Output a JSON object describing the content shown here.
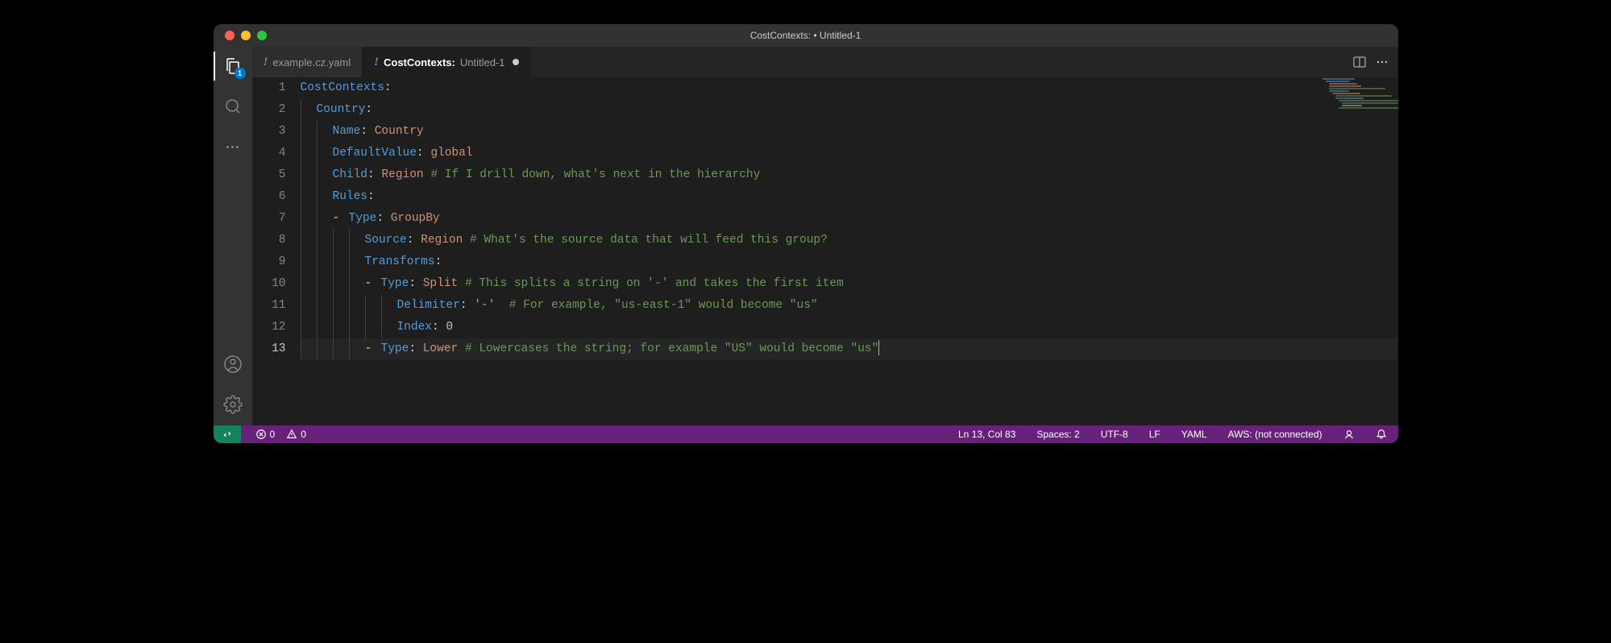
{
  "window": {
    "title": "CostContexts: • Untitled-1"
  },
  "sidebar": {
    "explorer_badge": "1"
  },
  "tabs": [
    {
      "icon": "!",
      "label": "example.cz.yaml",
      "dirty": false,
      "active": false
    },
    {
      "icon": "!",
      "label_main": "CostContexts:",
      "label_sub": "Untitled-1",
      "dirty": true,
      "active": true
    }
  ],
  "editor": {
    "line_numbers": [
      "1",
      "2",
      "3",
      "4",
      "5",
      "6",
      "7",
      "8",
      "9",
      "10",
      "11",
      "12",
      "13"
    ],
    "cursor_line": 13,
    "lines": [
      {
        "indent": 0,
        "tokens": [
          {
            "t": "CostContexts",
            "c": "k1"
          },
          {
            "t": ":",
            "c": "p"
          }
        ]
      },
      {
        "indent": 1,
        "tokens": [
          {
            "t": "Country",
            "c": "k1"
          },
          {
            "t": ":",
            "c": "p"
          }
        ]
      },
      {
        "indent": 2,
        "tokens": [
          {
            "t": "Name",
            "c": "k1"
          },
          {
            "t": ": ",
            "c": "p"
          },
          {
            "t": "Country",
            "c": "vstr"
          }
        ]
      },
      {
        "indent": 2,
        "tokens": [
          {
            "t": "DefaultValue",
            "c": "k1"
          },
          {
            "t": ": ",
            "c": "p"
          },
          {
            "t": "global",
            "c": "vstr"
          }
        ]
      },
      {
        "indent": 2,
        "tokens": [
          {
            "t": "Child",
            "c": "k1"
          },
          {
            "t": ": ",
            "c": "p"
          },
          {
            "t": "Region",
            "c": "vstr"
          },
          {
            "t": " ",
            "c": "p"
          },
          {
            "t": "# If I drill down, what's next in the hierarchy",
            "c": "cmt"
          }
        ]
      },
      {
        "indent": 2,
        "tokens": [
          {
            "t": "Rules",
            "c": "k1"
          },
          {
            "t": ":",
            "c": "p"
          }
        ]
      },
      {
        "indent": 3,
        "dash": true,
        "tokens": [
          {
            "t": "Type",
            "c": "k1"
          },
          {
            "t": ": ",
            "c": "p"
          },
          {
            "t": "GroupBy",
            "c": "vstr"
          }
        ]
      },
      {
        "indent": 4,
        "tokens": [
          {
            "t": "Source",
            "c": "k1"
          },
          {
            "t": ": ",
            "c": "p"
          },
          {
            "t": "Region",
            "c": "vstr"
          },
          {
            "t": " ",
            "c": "p"
          },
          {
            "t": "# What's the source data that will feed this group?",
            "c": "cmt"
          }
        ]
      },
      {
        "indent": 4,
        "tokens": [
          {
            "t": "Transforms",
            "c": "k1"
          },
          {
            "t": ":",
            "c": "p"
          }
        ]
      },
      {
        "indent": 5,
        "dash": true,
        "tokens": [
          {
            "t": "Type",
            "c": "k1"
          },
          {
            "t": ": ",
            "c": "p"
          },
          {
            "t": "Split",
            "c": "vstr"
          },
          {
            "t": " ",
            "c": "p"
          },
          {
            "t": "# This splits a string on '-' and takes the first item",
            "c": "cmt"
          }
        ]
      },
      {
        "indent": 6,
        "tokens": [
          {
            "t": "Delimiter",
            "c": "k1"
          },
          {
            "t": ": ",
            "c": "p"
          },
          {
            "t": "'-'",
            "c": "vstr"
          },
          {
            "t": "  ",
            "c": "p"
          },
          {
            "t": "# For example, \"us-east-1\" would become \"us\"",
            "c": "cmt"
          }
        ]
      },
      {
        "indent": 6,
        "tokens": [
          {
            "t": "Index",
            "c": "k1"
          },
          {
            "t": ": ",
            "c": "p"
          },
          {
            "t": "0",
            "c": "vnum"
          }
        ]
      },
      {
        "indent": 5,
        "dash": true,
        "tokens": [
          {
            "t": "Type",
            "c": "k1"
          },
          {
            "t": ": ",
            "c": "p"
          },
          {
            "t": "Lower",
            "c": "vstr"
          },
          {
            "t": " ",
            "c": "p"
          },
          {
            "t": "# Lowercases the string; for example \"US\" would become \"us\"",
            "c": "cmt"
          }
        ]
      }
    ]
  },
  "statusbar": {
    "errors": "0",
    "warnings": "0",
    "cursor": "Ln 13, Col 83",
    "spaces": "Spaces: 2",
    "encoding": "UTF-8",
    "eol": "LF",
    "language": "YAML",
    "aws": "AWS: (not connected)"
  }
}
